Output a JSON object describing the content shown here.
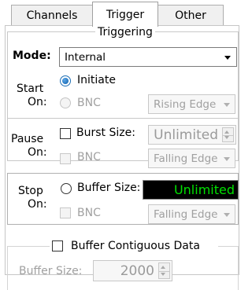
{
  "tabs": [
    {
      "label": "Channels",
      "active": false
    },
    {
      "label": "Trigger",
      "active": true
    },
    {
      "label": "Other",
      "active": false
    }
  ],
  "triggering": {
    "title": "Triggering",
    "mode_label": "Mode:",
    "mode_value": "Internal"
  },
  "start": {
    "label_line1": "Start",
    "label_line2": "On:",
    "initiate_label": "Initiate",
    "initiate_selected": true,
    "bnc_label": "BNC",
    "edge_value": "Rising Edge"
  },
  "pause": {
    "label_line1": "Pause",
    "label_line2": "On:",
    "burst_label": "Burst Size:",
    "burst_value": "Unlimited",
    "bnc_label": "BNC",
    "edge_value": "Falling Edge"
  },
  "stop": {
    "label_line1": "Stop",
    "label_line2": "On:",
    "buffer_label": "Buffer Size:",
    "buffer_value": "Unlimited",
    "bnc_label": "BNC",
    "edge_value": "Falling Edge"
  },
  "buffer": {
    "contiguous_label": "Buffer Contiguous Data",
    "size_label": "Buffer Size:",
    "size_value": "2000"
  },
  "colors": {
    "lcd_background": "#000000",
    "lcd_text": "#00e000",
    "radio_accent": "#0d5fa8",
    "disabled_text": "#a0a0a0"
  }
}
